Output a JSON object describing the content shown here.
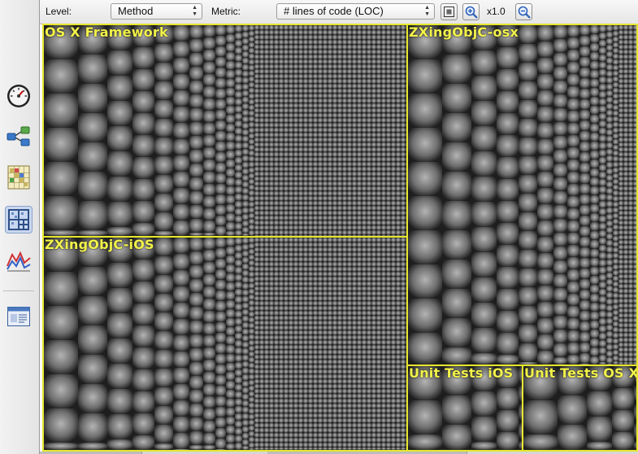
{
  "toolbar": {
    "level_label": "Level:",
    "level_value": "Method",
    "metric_label": "Metric:",
    "metric_value": "# lines of code (LOC)",
    "zoom_level": "x1.0",
    "fit_icon": "fit-to-window-icon",
    "zoom_in_icon": "zoom-in-icon",
    "zoom_out_icon": "zoom-out-icon"
  },
  "sidebar": {
    "items": [
      {
        "name": "dashboard",
        "icon": "dashboard-gauge-icon"
      },
      {
        "name": "dependency-graph",
        "icon": "dependency-graph-icon"
      },
      {
        "name": "dependency-matrix",
        "icon": "dependency-matrix-icon"
      },
      {
        "name": "metrics-treemap",
        "icon": "treemap-icon",
        "active": true
      },
      {
        "name": "trend-chart",
        "icon": "trend-chart-icon"
      },
      {
        "name": "report",
        "icon": "report-window-icon"
      }
    ]
  },
  "treemap": {
    "accent": "#e6e62e",
    "cells": [
      {
        "label": "OS X Framework"
      },
      {
        "label": "ZXingObjC-iOS"
      },
      {
        "label": "ZXingObjC-osx"
      },
      {
        "label": "Unit Tests iOS"
      },
      {
        "label": "Unit Tests OS X"
      }
    ]
  }
}
